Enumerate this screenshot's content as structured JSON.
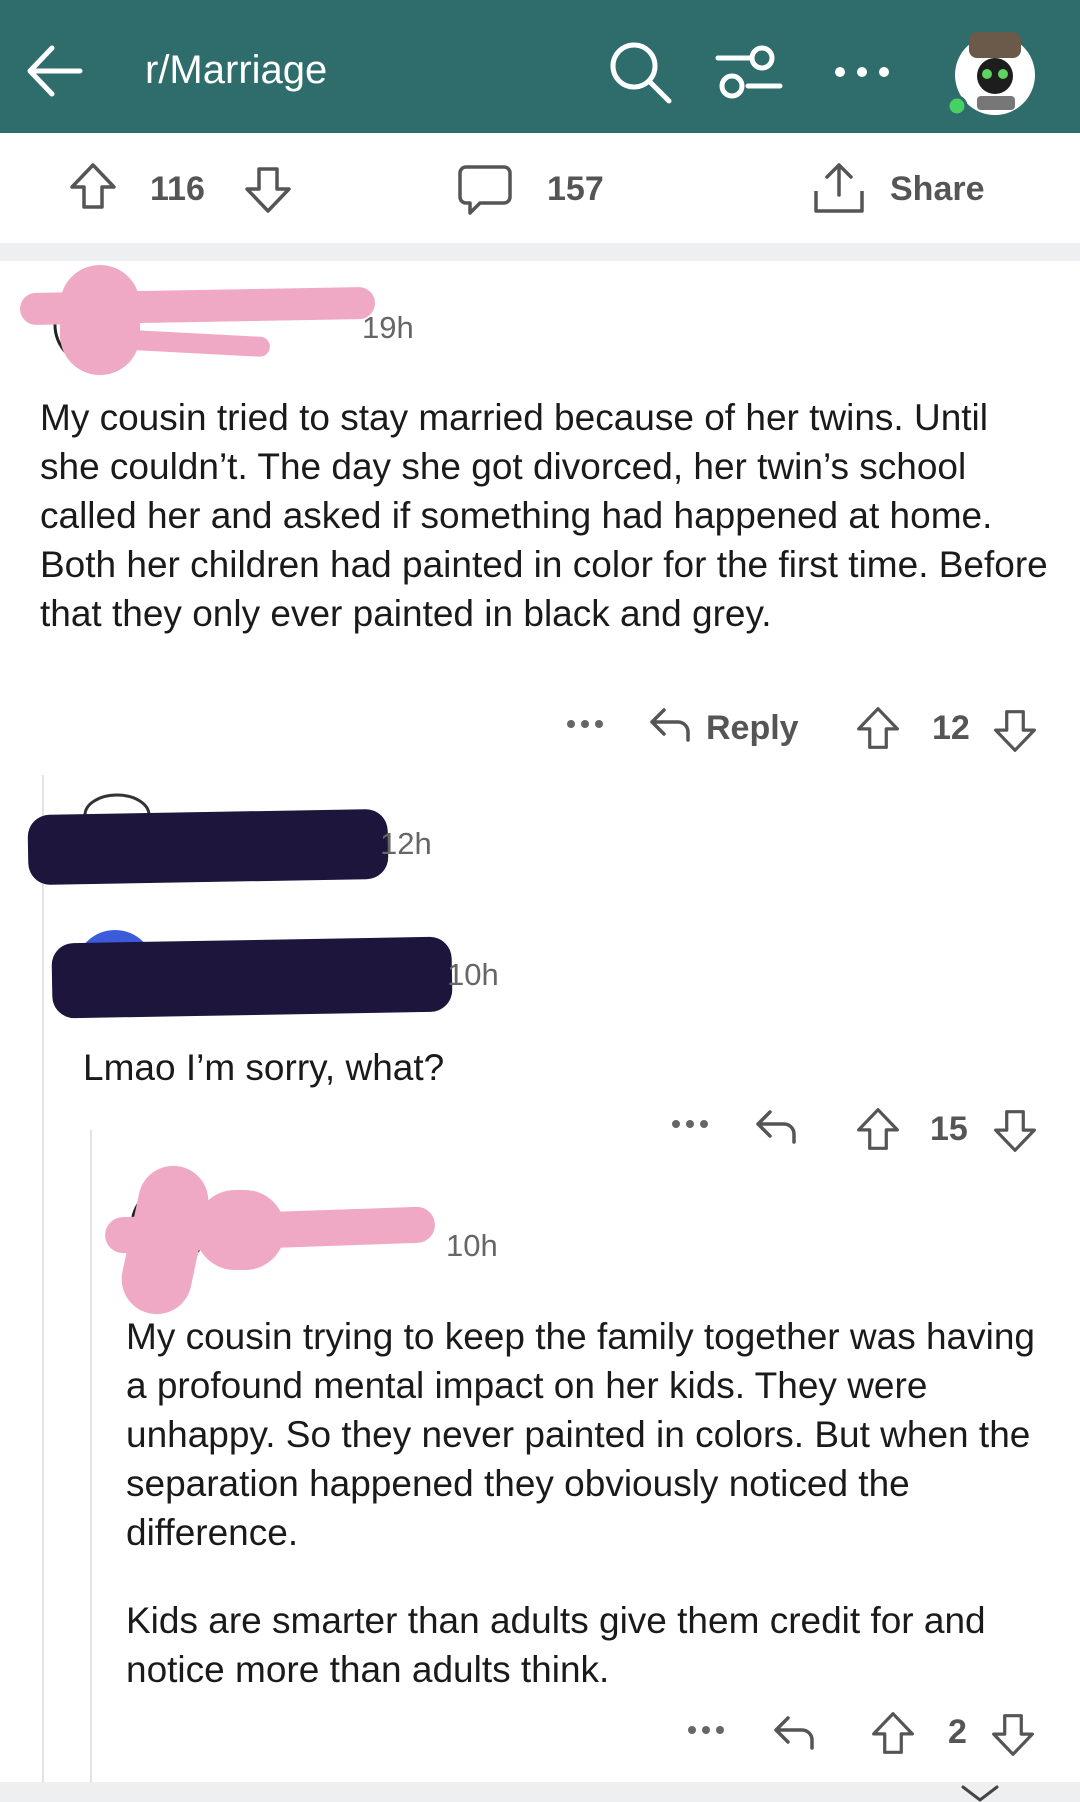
{
  "header": {
    "subreddit": "r/Marriage",
    "colors": {
      "bar": "#2e6d6b",
      "redact_pink": "#f0a9c4",
      "redact_navy": "#1d153c"
    }
  },
  "post_actions": {
    "upvotes": "116",
    "comments": "157",
    "share_label": "Share"
  },
  "comments": [
    {
      "time": "19h",
      "text": "My cousin tried to stay married because of her twins. Until she couldn’t. The day she got divorced, her twin’s school called her and asked if something had happened at home. Both her children had painted in color for the first time. Before that they only ever painted in black and grey.",
      "reply_label": "Reply",
      "votes": "12"
    },
    {
      "time": "12h"
    },
    {
      "time": "10h",
      "text": "Lmao I’m sorry, what?",
      "votes": "15"
    },
    {
      "time": "10h",
      "paragraph1": "My cousin trying to keep the family together was having a profound mental impact on her kids. They were unhappy. So they never painted in colors. But when the separation happened they obviously noticed the difference.",
      "paragraph2": "Kids are smarter than adults give them credit for and notice more than adults think.",
      "votes": "2"
    }
  ],
  "icons": [
    "back-arrow-icon",
    "search-icon",
    "filter-icon",
    "more-icon",
    "avatar",
    "upvote-icon",
    "downvote-icon",
    "comment-icon",
    "share-icon",
    "reply-icon",
    "chevron-down-icon"
  ]
}
